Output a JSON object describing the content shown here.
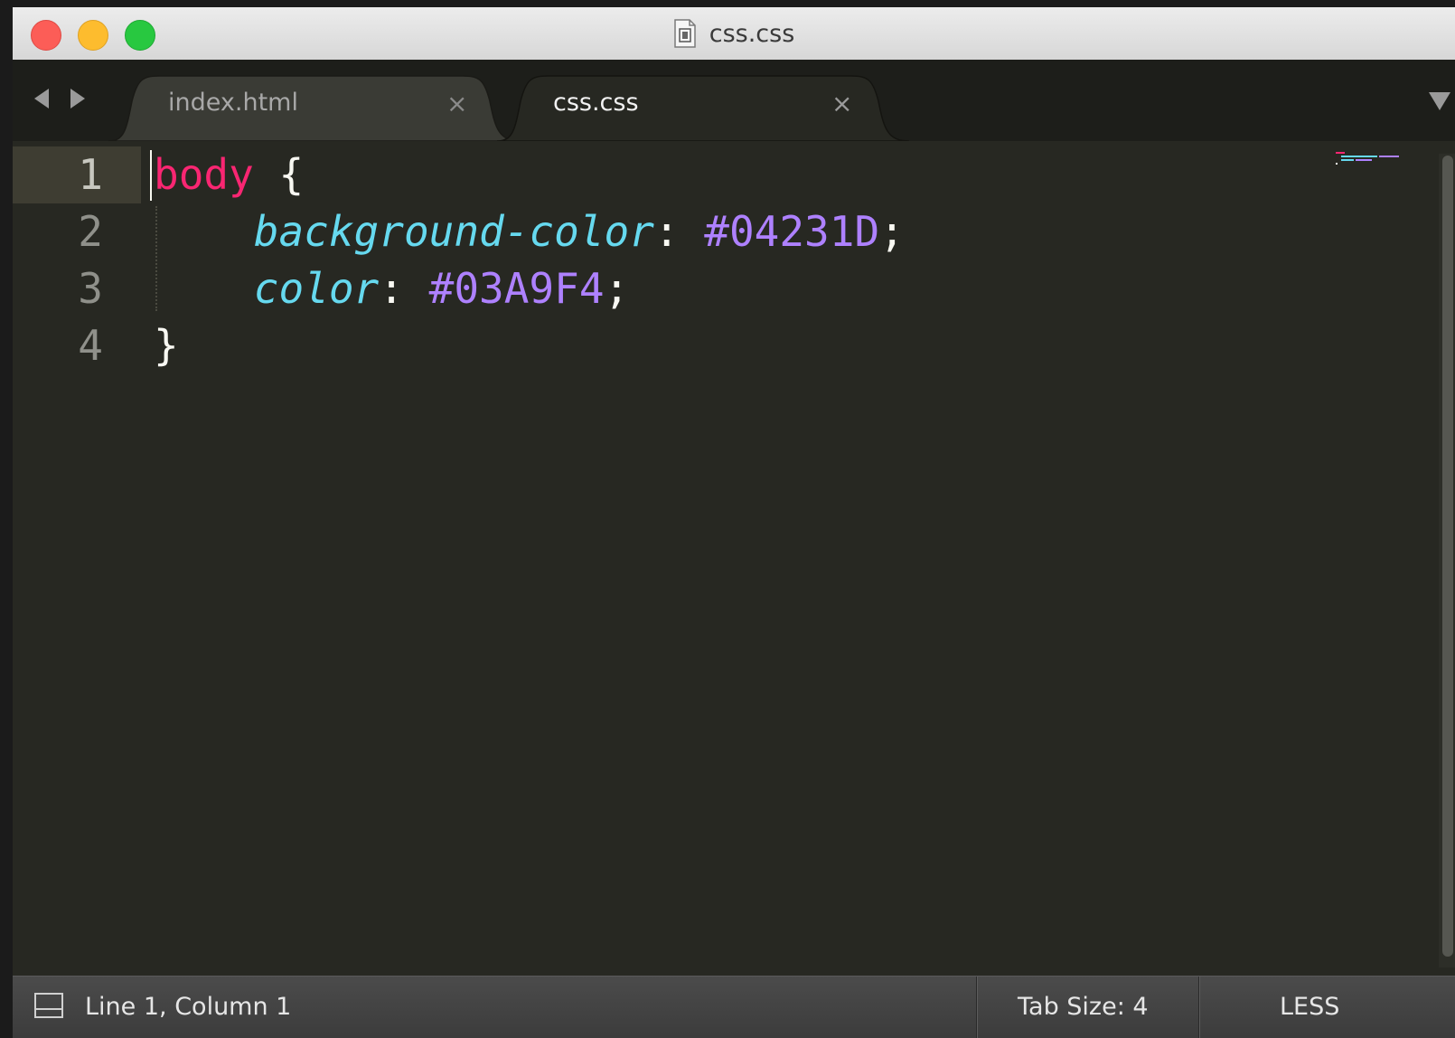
{
  "window": {
    "title": "css.css"
  },
  "tabs": [
    {
      "label": "index.html",
      "close_label": "×",
      "active": false
    },
    {
      "label": "css.css",
      "close_label": "×",
      "active": true
    }
  ],
  "editor": {
    "line_numbers": [
      "1",
      "2",
      "3",
      "4"
    ],
    "current_line": "1",
    "code": [
      [
        {
          "t": "selector",
          "v": "body"
        },
        {
          "t": "brace",
          "v": " {"
        }
      ],
      [
        {
          "t": "punct",
          "v": "    "
        },
        {
          "t": "prop",
          "v": "background-color"
        },
        {
          "t": "punct",
          "v": ": "
        },
        {
          "t": "value",
          "v": "#04231D"
        },
        {
          "t": "punct",
          "v": ";"
        }
      ],
      [
        {
          "t": "punct",
          "v": "    "
        },
        {
          "t": "prop",
          "v": "color"
        },
        {
          "t": "punct",
          "v": ": "
        },
        {
          "t": "value",
          "v": "#03A9F4"
        },
        {
          "t": "punct",
          "v": ";"
        }
      ],
      [
        {
          "t": "brace",
          "v": "}"
        }
      ]
    ],
    "theme": {
      "background": "#272822",
      "selector": "#f92672",
      "property": "#66d9ef",
      "value": "#ae81ff",
      "text": "#f8f8f2"
    }
  },
  "statusbar": {
    "position": "Line 1, Column 1",
    "tab_size": "Tab Size: 4",
    "syntax": "LESS"
  }
}
